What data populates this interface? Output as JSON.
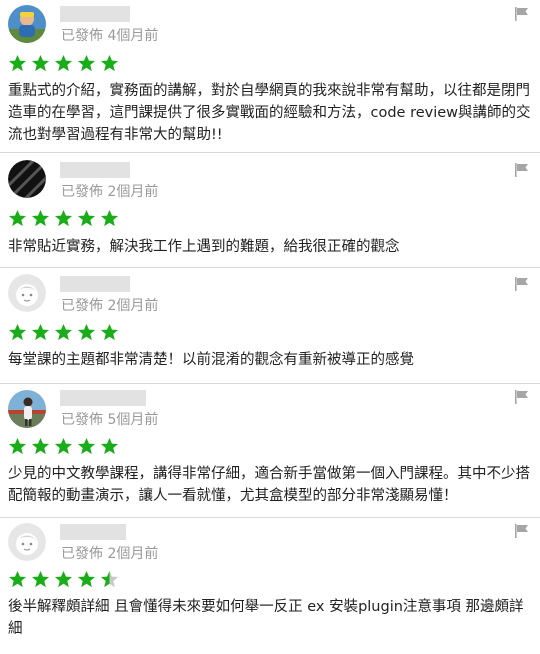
{
  "colors": {
    "star": "#1aad19",
    "star_empty": "#c8c8c8",
    "placeholder": "#e2e2e2",
    "meta": "#9a9a9a"
  },
  "reviews": [
    {
      "avatar": "photo-avatar-cyclist",
      "date": "已發佈 4個月前",
      "rating": 5,
      "text": "重點式的介紹，實務面的講解，對於自學網頁的我來說非常有幫助，以往都是閉門造車的在學習，這門課提供了很多實戰面的經驗和方法，code review與講師的交流也對學習過程有非常大的幫助!!"
    },
    {
      "avatar": "striped-avatar",
      "date": "已發佈 2個月前",
      "rating": 5,
      "text": "非常貼近實務，解決我工作上遇到的難題，給我很正確的觀念"
    },
    {
      "avatar": "default-avatar",
      "date": "已發佈 2個月前",
      "rating": 5,
      "text": "每堂課的主題都非常清楚！以前混淆的觀念有重新被導正的感覺"
    },
    {
      "avatar": "photo-avatar-person",
      "date": "已發佈 5個月前",
      "rating": 5,
      "text": "少見的中文教學課程，講得非常仔細，適合新手當做第一個入門課程。其中不少搭配簡報的動畫演示，讓人一看就懂，尤其盒模型的部分非常淺顯易懂！"
    },
    {
      "avatar": "default-avatar",
      "date": "已發佈 2個月前",
      "rating": 4.5,
      "text": "後半解釋頗詳細 且會懂得未來要如何舉一反正 ex 安裝plugin注意事項 那邊頗詳細"
    }
  ]
}
